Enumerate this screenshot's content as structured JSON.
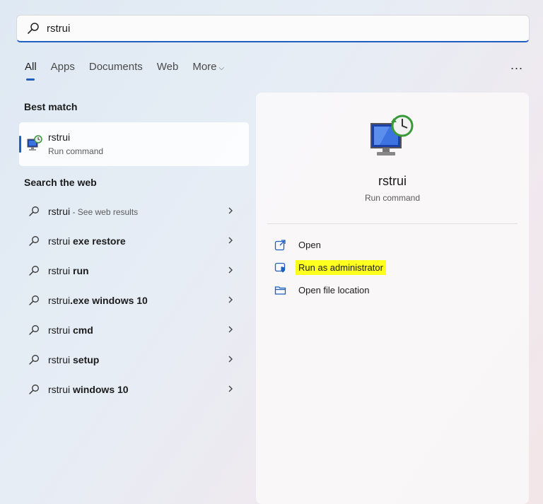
{
  "search": {
    "query": "rstrui"
  },
  "tabs": [
    {
      "label": "All",
      "active": true
    },
    {
      "label": "Apps"
    },
    {
      "label": "Documents"
    },
    {
      "label": "Web"
    },
    {
      "label": "More"
    }
  ],
  "more_options": "...",
  "best_match": {
    "title": "Best match",
    "name": "rstrui",
    "subtitle": "Run command"
  },
  "web": {
    "title": "Search the web",
    "items": [
      {
        "prefix": "rstrui",
        "bold": "",
        "suffix": " - See web results"
      },
      {
        "prefix": "rstrui ",
        "bold": "exe restore",
        "suffix": ""
      },
      {
        "prefix": "rstrui ",
        "bold": "run",
        "suffix": ""
      },
      {
        "prefix": "rstrui",
        "bold": ".exe windows 10",
        "suffix": ""
      },
      {
        "prefix": "rstrui ",
        "bold": "cmd",
        "suffix": ""
      },
      {
        "prefix": "rstrui ",
        "bold": "setup",
        "suffix": ""
      },
      {
        "prefix": "rstrui ",
        "bold": "windows 10",
        "suffix": ""
      }
    ]
  },
  "details": {
    "name": "rstrui",
    "subtitle": "Run command",
    "actions": [
      {
        "label": "Open",
        "icon": "open-external-icon"
      },
      {
        "label": "Run as administrator",
        "icon": "shield-admin-icon",
        "highlighted": true
      },
      {
        "label": "Open file location",
        "icon": "folder-icon"
      }
    ]
  },
  "colors": {
    "accent": "#1f5fbf",
    "highlight": "#ffff1f"
  }
}
